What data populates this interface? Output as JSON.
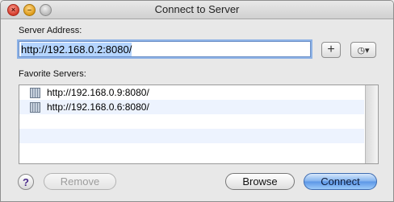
{
  "window": {
    "title": "Connect to Server",
    "traffic_lights": [
      "close",
      "minimize",
      "zoom"
    ]
  },
  "server_address": {
    "label": "Server Address:",
    "value": "http://192.168.0.2:8080/"
  },
  "toolbar": {
    "add_label": "+",
    "history_label": "◷▾"
  },
  "favorites": {
    "label": "Favorite Servers:",
    "items": [
      {
        "label": "http://192.168.0.9:8080/",
        "icon": "server-icon"
      },
      {
        "label": "http://192.168.0.6:8080/",
        "icon": "server-icon"
      }
    ]
  },
  "buttons": {
    "help": "?",
    "remove": "Remove",
    "browse": "Browse",
    "connect": "Connect"
  },
  "colors": {
    "accent": "#5a95e6",
    "selection": "#b5d5ff",
    "alt_row": "#edf3fe"
  }
}
